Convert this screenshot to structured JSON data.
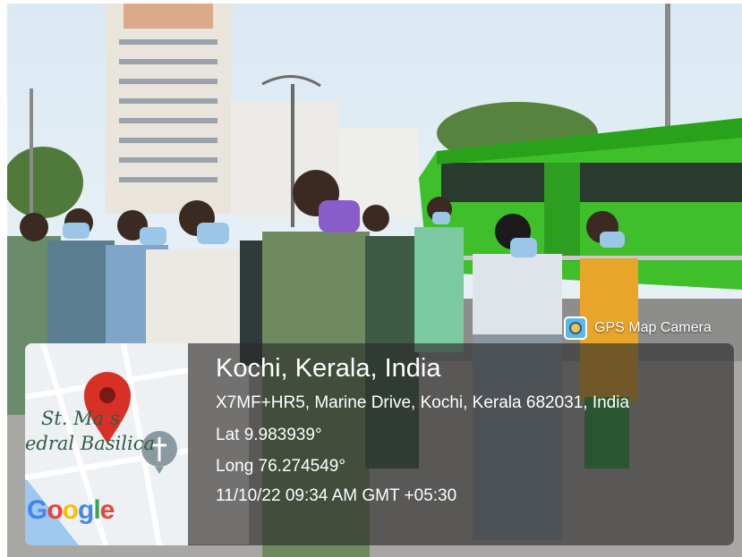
{
  "badge": {
    "label": "GPS Map Camera",
    "icon": "gps-camera-icon"
  },
  "map": {
    "label_line1": "St. Ma  s",
    "label_line2": "edral Basilica",
    "brand": [
      "G",
      "o",
      "o",
      "g",
      "l",
      "e"
    ],
    "pin_color": "#d93025"
  },
  "location": {
    "place": "Kochi, Kerala, India",
    "address": "X7MF+HR5, Marine Drive, Kochi, Kerala 682031, India",
    "latitude": "Lat 9.983939°",
    "longitude": "Long 76.274549°",
    "timestamp": "11/10/22 09:34 AM GMT +05:30"
  },
  "colors": {
    "bus": "#3fbf2a",
    "sky": "#eaf2f7",
    "overlay": "#282828"
  }
}
